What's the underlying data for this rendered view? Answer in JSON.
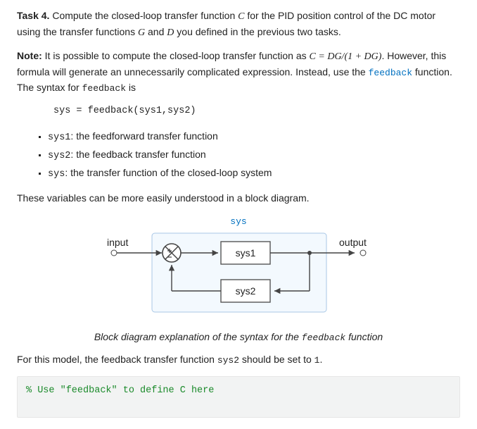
{
  "task": {
    "heading_bold": "Task 4.",
    "heading_rest": " Compute the closed-loop transfer function ",
    "var_C": "C",
    "heading_rest2": " for the PID position control of the DC motor using the transfer functions ",
    "var_G": "G",
    "and_word": " and ",
    "var_D": "D",
    "heading_rest3": " you defined in the previous two tasks."
  },
  "note": {
    "label": "Note:",
    "text1": " It is possible to compute the closed-loop transfer function as ",
    "formula": "C = DG/(1 + DG)",
    "text2": ". However, this formula will generate an unnecessarily complicated expression. Instead, use the ",
    "link_text": "feedback",
    "text3": " function. The syntax for ",
    "code_word": "feedback",
    "text4": " is"
  },
  "syntax_line": "sys = feedback(sys1,sys2)",
  "bullets": [
    {
      "code": "sys1",
      "sep": ": ",
      "desc": "the feedforward transfer function"
    },
    {
      "code": "sys2",
      "sep": ": ",
      "desc": "the feedback transfer function"
    },
    {
      "code": "sys",
      "sep": ": ",
      "desc": "the transfer function of the closed-loop system"
    }
  ],
  "pre_diagram_text": "These variables can be more easily understood in a block diagram.",
  "diagram": {
    "sys_label": "sys",
    "input_label": "input",
    "output_label": "output",
    "sys1_label": "sys1",
    "sys2_label": "sys2"
  },
  "caption": {
    "prefix": "Block diagram explanation of the syntax for the ",
    "code": "feedback",
    "suffix": " function"
  },
  "post_diagram": {
    "text1": "For this model, the feedback transfer function ",
    "code": "sys2",
    "text2": " should be set to ",
    "one": "1",
    "period": "."
  },
  "code_block": "% Use \"feedback\" to define C here"
}
